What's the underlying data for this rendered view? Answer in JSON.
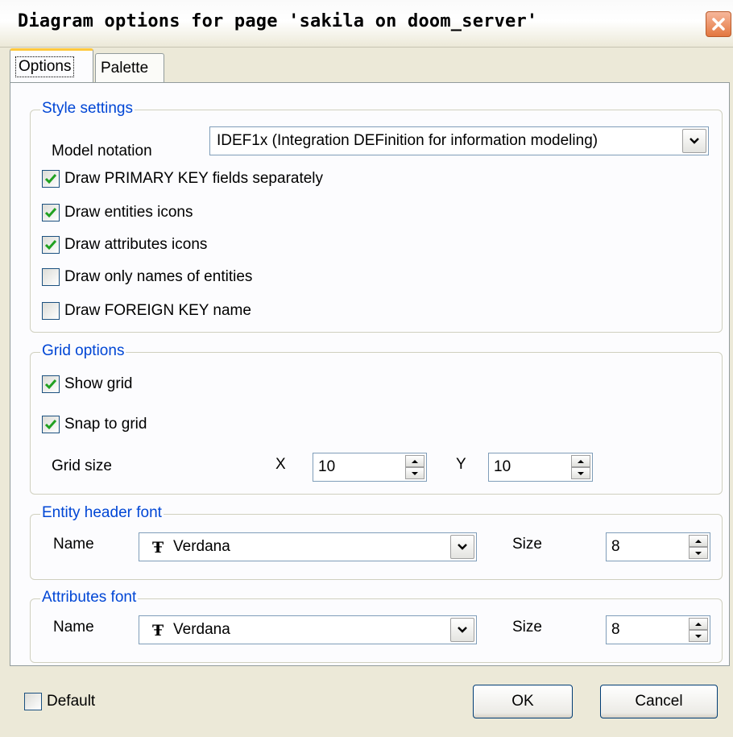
{
  "window": {
    "title": "Diagram options for page 'sakila on doom_server'"
  },
  "tabs": [
    {
      "label": "Options"
    },
    {
      "label": "Palette"
    }
  ],
  "style_settings": {
    "legend": "Style settings",
    "model_notation_label": "Model notation",
    "model_notation_value": "IDEF1x (Integration DEFinition for information modeling)",
    "checkboxes": [
      {
        "label": "Draw PRIMARY KEY fields separately",
        "checked": true
      },
      {
        "label": "Draw entities icons",
        "checked": true
      },
      {
        "label": "Draw attributes icons",
        "checked": true
      },
      {
        "label": "Draw only names of entities",
        "checked": false
      },
      {
        "label": "Draw FOREIGN KEY name",
        "checked": false
      }
    ]
  },
  "grid_options": {
    "legend": "Grid options",
    "show_grid": {
      "label": "Show grid",
      "checked": true
    },
    "snap_to_grid": {
      "label": "Snap to grid",
      "checked": true
    },
    "grid_size_label": "Grid size",
    "x_label": "X",
    "x_value": "10",
    "y_label": "Y",
    "y_value": "10"
  },
  "entity_header_font": {
    "legend": "Entity header font",
    "name_label": "Name",
    "name_value": "Verdana",
    "size_label": "Size",
    "size_value": "8"
  },
  "attributes_font": {
    "legend": "Attributes font",
    "name_label": "Name",
    "name_value": "Verdana",
    "size_label": "Size",
    "size_value": "8"
  },
  "footer": {
    "default": {
      "label": "Default",
      "checked": false
    },
    "ok_label": "OK",
    "cancel_label": "Cancel"
  },
  "icons": {
    "font_icon_glyph": "Ŧ"
  },
  "colors": {
    "accent": "#0046d5",
    "check": "#21a121",
    "close": "#e3773f",
    "tab_highlight": "#ffc83c"
  }
}
